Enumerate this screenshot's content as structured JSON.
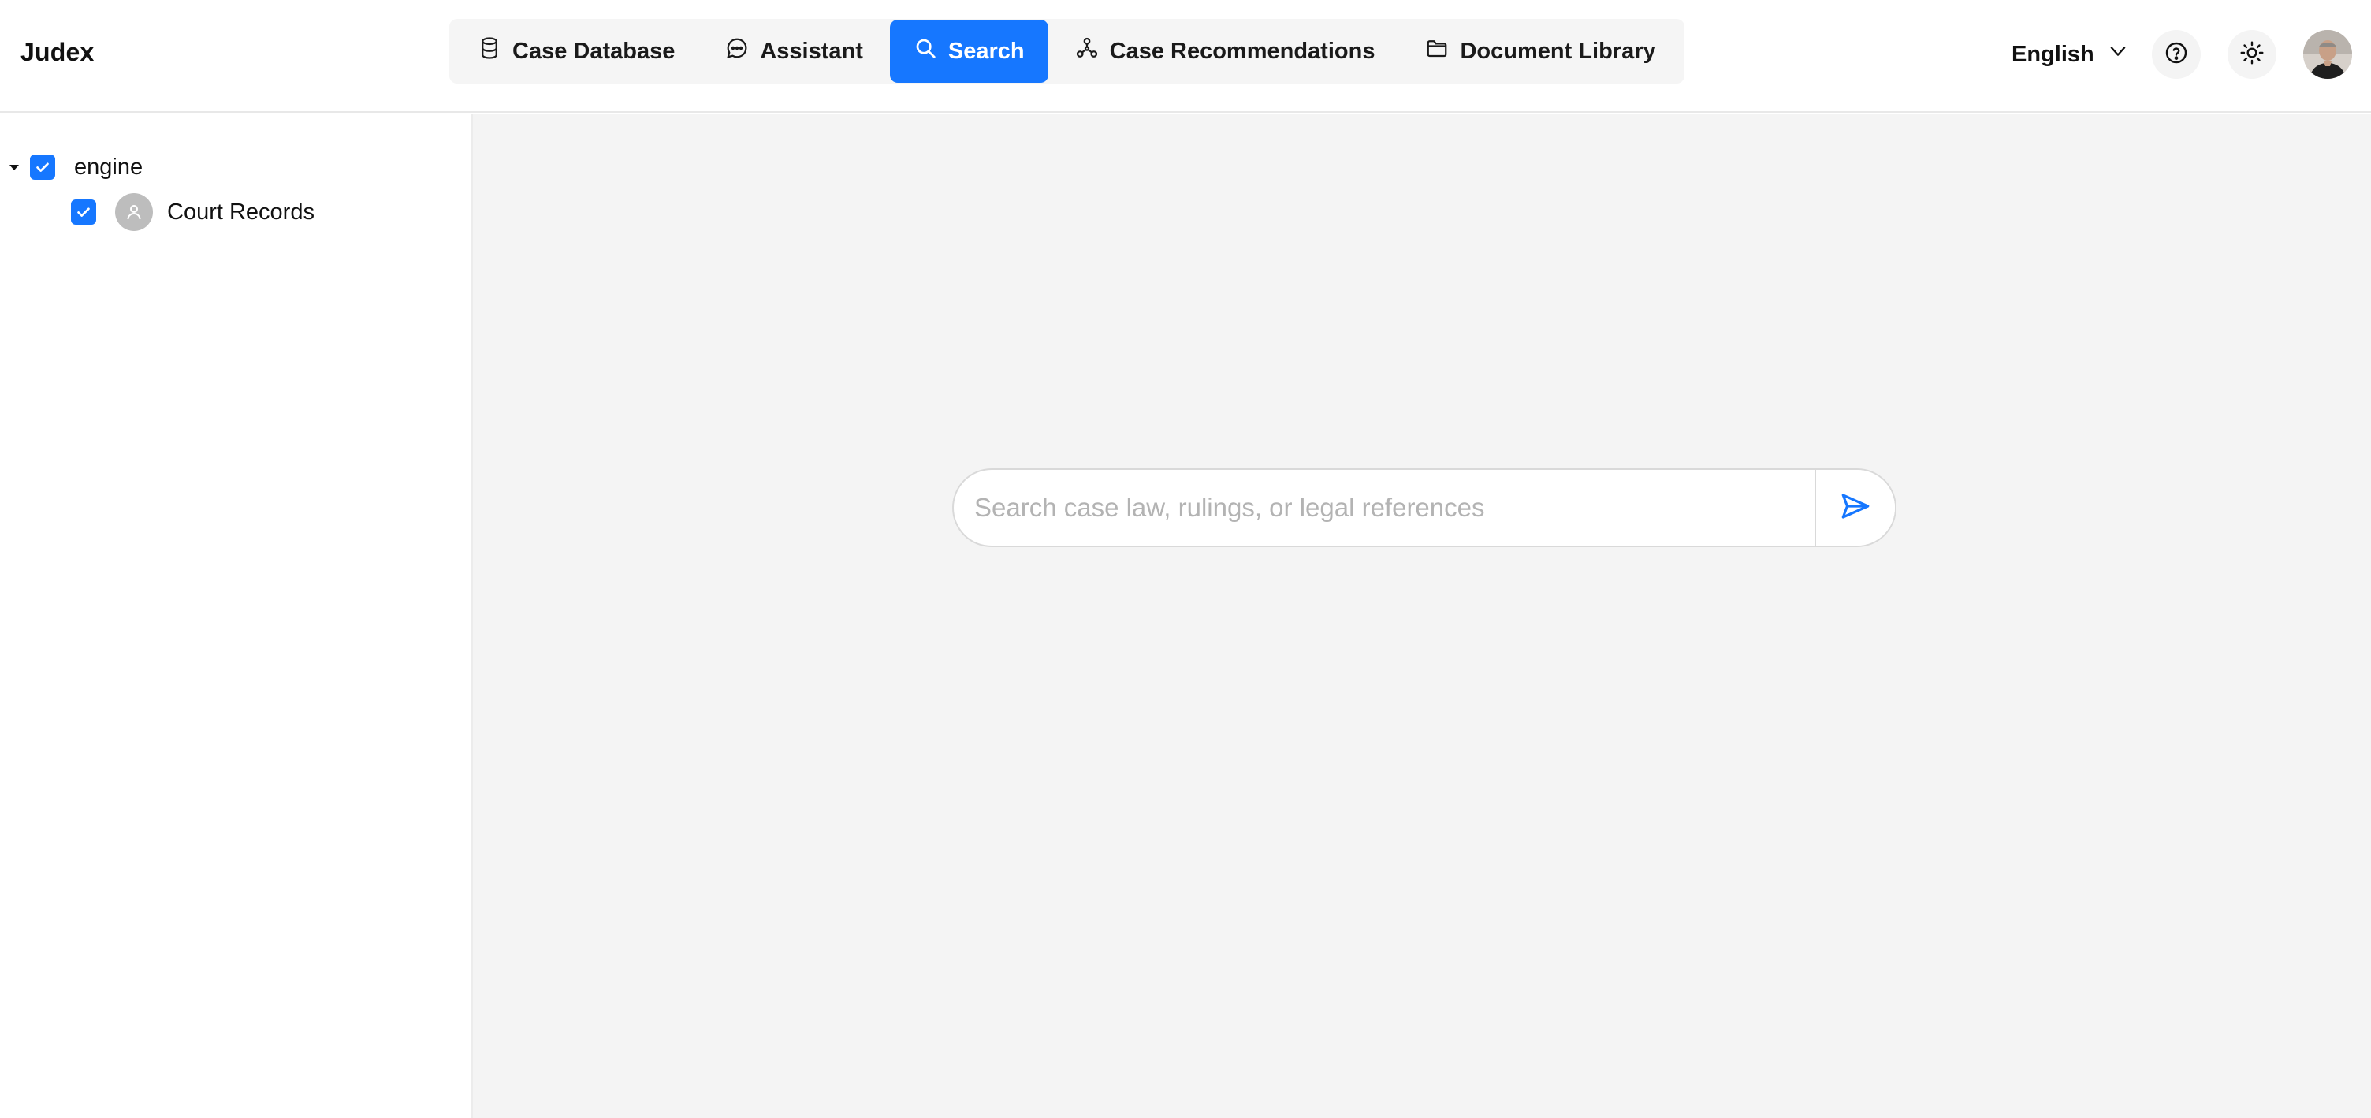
{
  "app": {
    "name": "Judex"
  },
  "nav": {
    "tabs": [
      {
        "label": "Case Database",
        "icon": "database-icon",
        "active": false
      },
      {
        "label": "Assistant",
        "icon": "chat-bubble-icon",
        "active": false
      },
      {
        "label": "Search",
        "icon": "search-icon",
        "active": true
      },
      {
        "label": "Case Recommendations",
        "icon": "network-icon",
        "active": false
      },
      {
        "label": "Document Library",
        "icon": "folder-icon",
        "active": false
      }
    ]
  },
  "header": {
    "language": "English"
  },
  "sidebar": {
    "tree": {
      "root": {
        "label": "engine",
        "checked": true,
        "expanded": true
      },
      "children": [
        {
          "label": "Court Records",
          "checked": true,
          "icon": "user-icon"
        }
      ]
    }
  },
  "search": {
    "placeholder": "Search case law, rulings, or legal references",
    "value": ""
  },
  "colors": {
    "accent": "#1677ff",
    "main_background": "#f4f4f4"
  }
}
